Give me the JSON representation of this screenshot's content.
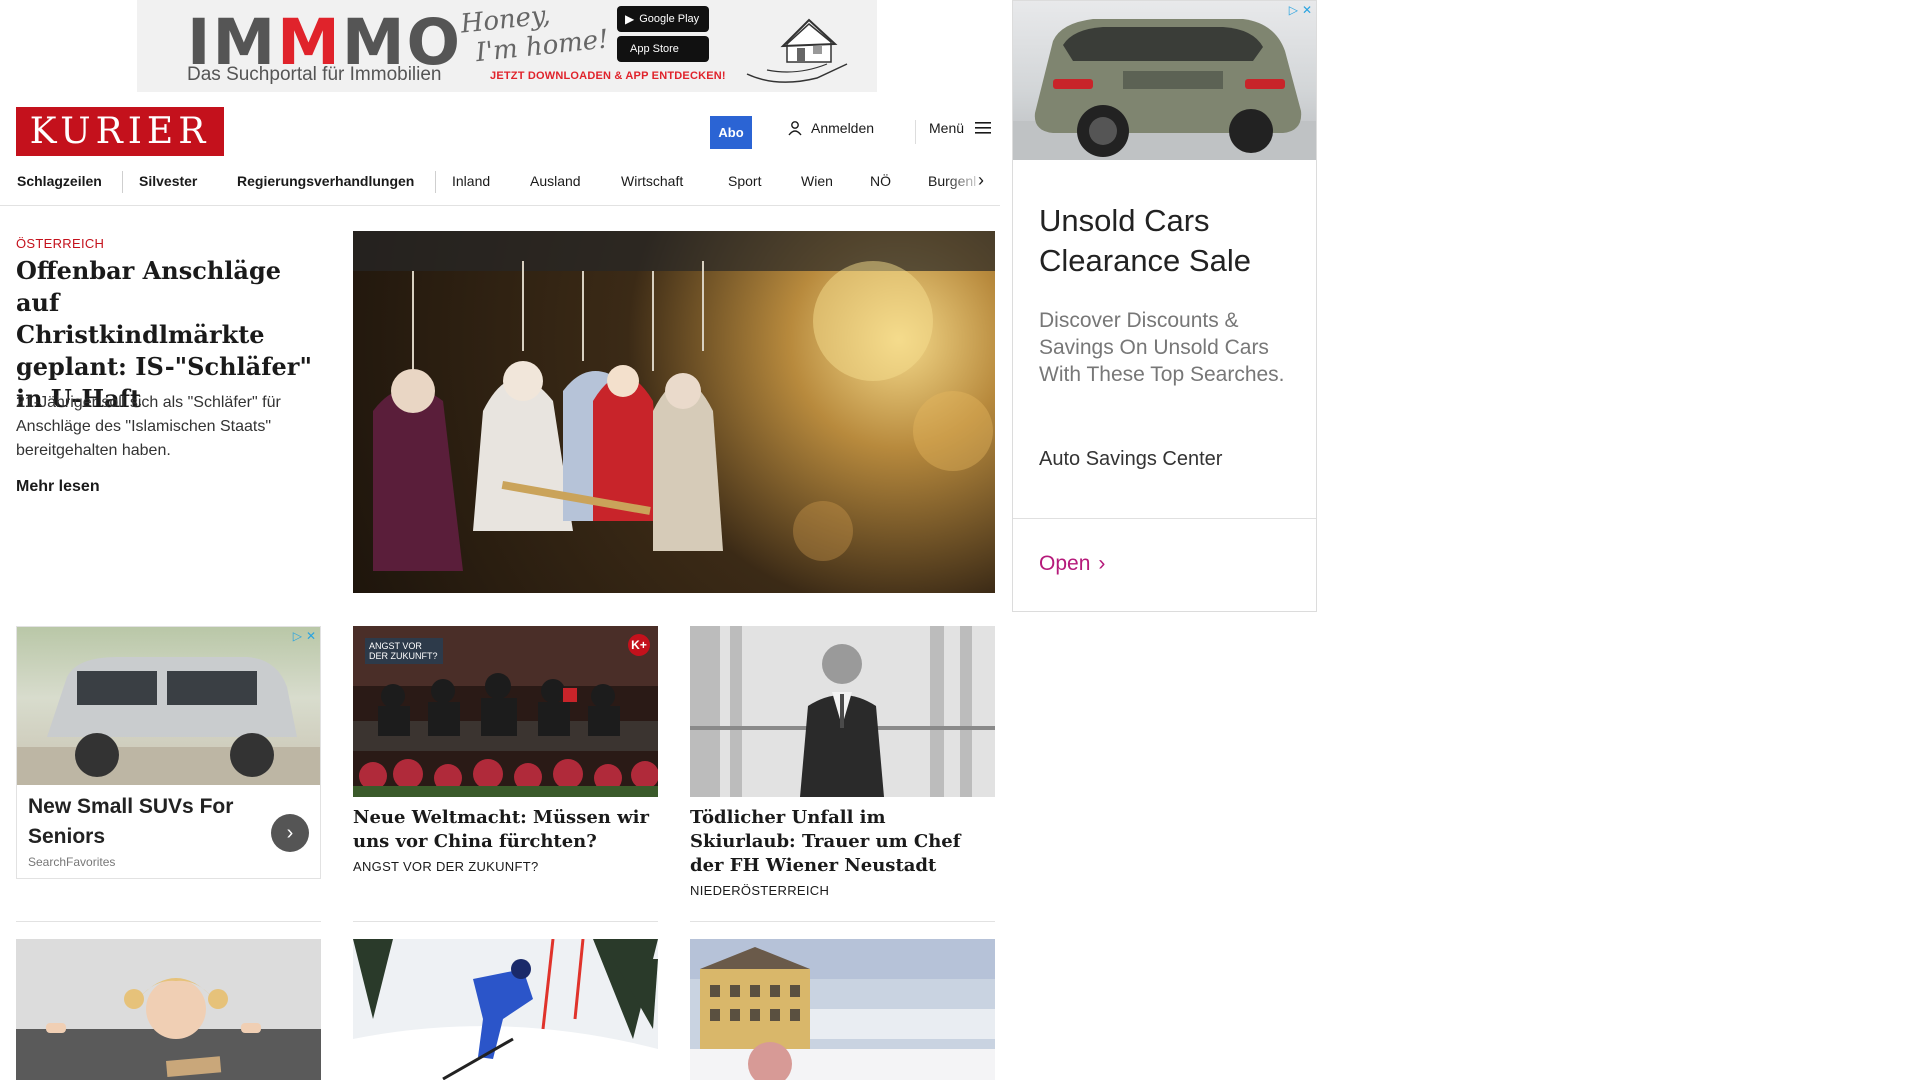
{
  "top_ad": {
    "brand_prefix": "IM",
    "brand_accent": "M",
    "brand_suffix": "MO",
    "tagline": "Das Suchportal für Immobilien",
    "script_line1": "Honey,",
    "script_line2": "I'm home!",
    "google_play": "Google Play",
    "app_store": "App Store",
    "cta": "JETZT DOWNLOADEN & APP ENTDECKEN!"
  },
  "side_ad": {
    "title": "Unsold Cars Clearance Sale",
    "description": "Discover Discounts & Savings On Unsold Cars With These Top Searches.",
    "advertiser": "Auto Savings Center",
    "cta": "Open"
  },
  "header": {
    "logo": "KURIER",
    "abo": "Abo",
    "login": "Anmelden",
    "menu": "Menü"
  },
  "nav": {
    "items": [
      "Schlagzeilen",
      "Silvester",
      "Regierungsverhandlungen",
      "Inland",
      "Ausland",
      "Wirtschaft",
      "Sport",
      "Wien",
      "NÖ",
      "Burgenl"
    ]
  },
  "lead": {
    "kicker": "ÖSTERREICH",
    "title": "Offenbar Anschläge auf Christkindlmärkte geplant: IS-\"Schläfer\" in U-Haft",
    "teaser": "21-Jähriger soll sich als \"Schläfer\" für Anschläge des \"Islamischen Staats\" bereitgehalten haben.",
    "read_more": "Mehr lesen"
  },
  "ad_card": {
    "title": "New Small SUVs For Seniors",
    "source": "SearchFavorites"
  },
  "cards": [
    {
      "badge": "ANGST VOR DER ZUKUNFT?",
      "plus": "K+",
      "title": "Neue Weltmacht: Müssen wir uns vor China fürchten?",
      "kicker": "ANGST VOR DER ZUKUNFT?"
    },
    {
      "title": "Tödlicher Unfall im Skiurlaub: Trauer um Chef der FH Wiener Neustadt",
      "kicker": "NIEDERÖSTERREICH"
    }
  ],
  "colors": {
    "brand_red": "#c4111c",
    "abo_blue": "#2b64d4",
    "ad_accent": "#b5197a"
  },
  "icons": [
    "user-icon",
    "hamburger-icon",
    "chevron-right-icon",
    "adchoices-icon",
    "close-icon"
  ]
}
